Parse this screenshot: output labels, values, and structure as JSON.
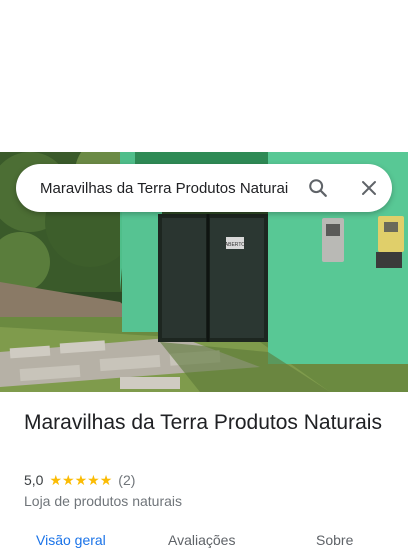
{
  "search": {
    "query": "Maravilhas da Terra Produtos Naturais"
  },
  "place": {
    "title": "Maravilhas da Terra Produtos Naturais",
    "rating": "5,0",
    "stars": [
      "★",
      "★",
      "★",
      "★",
      "★"
    ],
    "review_count": "(2)",
    "category": "Loja de produtos naturais"
  },
  "tabs": [
    {
      "label": "Visão geral",
      "active": true
    },
    {
      "label": "Avaliações",
      "active": false
    },
    {
      "label": "Sobre",
      "active": false
    }
  ],
  "photo": {
    "sign_text": "ABERTO"
  },
  "colors": {
    "accent": "#1a73e8",
    "star": "#fbbc04",
    "wall": "#4fbe8a"
  }
}
